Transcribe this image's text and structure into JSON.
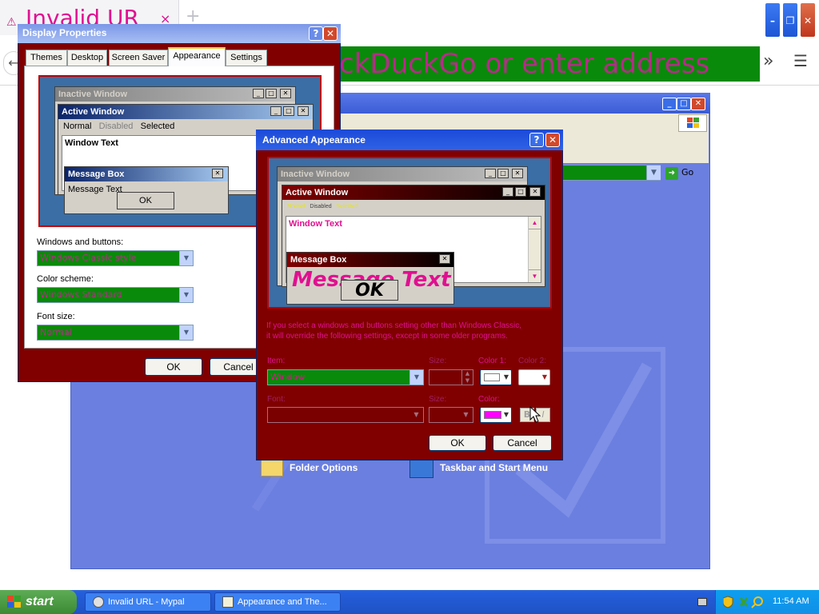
{
  "browser": {
    "tab_title": "Invalid UR",
    "tab_warn": "⚠",
    "tab_close": "×",
    "new_tab": "+",
    "url_text": "ckDuckGo or enter address",
    "back": "←",
    "overflow": "»",
    "menu": "☰",
    "min": "–",
    "max": "❐",
    "close": "✕"
  },
  "control_panel": {
    "go_label": "Go",
    "links": [
      "Folder Options",
      "Taskbar and Start Menu"
    ]
  },
  "display_properties": {
    "title": "Display Properties",
    "tabs": [
      "Themes",
      "Desktop",
      "Screen Saver",
      "Appearance",
      "Settings"
    ],
    "active_tab": "Appearance",
    "preview": {
      "inactive_title": "Inactive Window",
      "active_title": "Active Window",
      "menu": [
        "Normal",
        "Disabled",
        "Selected"
      ],
      "window_text": "Window Text",
      "msgbox_title": "Message Box",
      "msgbox_text": "Message Text",
      "ok": "OK"
    },
    "windows_buttons_label": "Windows and buttons:",
    "windows_buttons_value": "Windows Classic style",
    "color_scheme_label": "Color scheme:",
    "color_scheme_value": "Windows Standard",
    "font_size_label": "Font size:",
    "font_size_value": "Normal",
    "ok": "OK",
    "cancel": "Cancel"
  },
  "advanced_appearance": {
    "title": "Advanced Appearance",
    "preview": {
      "inactive_title": "Inactive Window",
      "active_title": "Active Window",
      "menu": [
        "Normal",
        "Disabled",
        "Selected"
      ],
      "window_text": "Window Text",
      "msgbox_title": "Message Box",
      "msgbox_text": "Message Text",
      "ok": "OK"
    },
    "note_line1": "If you select a windows and buttons setting other than Windows Classic,",
    "note_line2": "it will override the following settings, except in some older programs.",
    "item_label": "Item:",
    "item_value": "Window",
    "size_label": "Size:",
    "color1_label": "Color 1:",
    "color2_label": "Color 2:",
    "font_label": "Font:",
    "size2_label": "Size:",
    "color_label": "Color:",
    "bold": "B",
    "italic": "I",
    "ok": "OK",
    "cancel": "Cancel"
  },
  "taskbar": {
    "start": "start",
    "items": [
      "Invalid URL - Mypal",
      "Appearance and The..."
    ],
    "clock": "11:54 AM"
  },
  "colors": {
    "dialog_bg": "#800000",
    "accent_green": "#0a8a0a",
    "text_magenta": "#e01090",
    "desktop_blue": "#6b7fe0"
  }
}
